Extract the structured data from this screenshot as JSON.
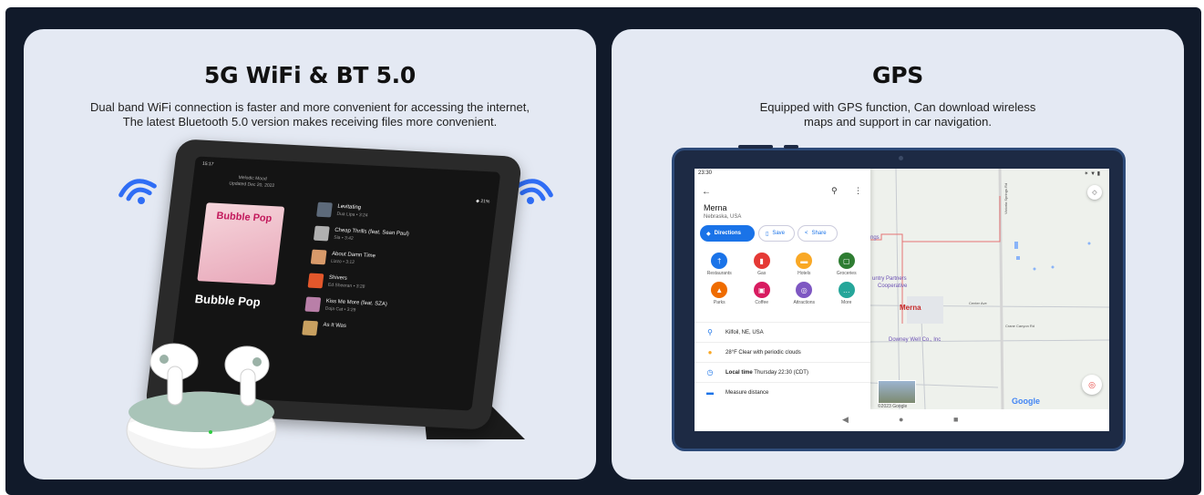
{
  "left_card": {
    "title": "5G WiFi & BT 5.0",
    "desc_line1": "Dual band WiFi connection is faster and more convenient for accessing the internet,",
    "desc_line2": "The latest Bluetooth 5.0 version makes receiving files more convenient.",
    "icons": [
      "wifi-icon-left",
      "wifi-icon-right"
    ],
    "accent_color": "#2f6df5"
  },
  "music_app": {
    "clock": "15:17",
    "battery": "◆ 21%",
    "playlist_meta_1": "Melodic Mood",
    "playlist_meta_2": "Updated Dec 20, 2022",
    "album_text": "Bubble Pop",
    "playlist_title": "Bubble Pop",
    "tracks": [
      {
        "title": "Levitating",
        "sub": "Dua Lipa • 3:24",
        "color": "#5d6a7a"
      },
      {
        "title": "Cheap Thrills (feat. Sean Paul)",
        "sub": "Sia • 3:42",
        "color": "#b0b0b0"
      },
      {
        "title": "About Damn Time",
        "sub": "Lizzo • 3:12",
        "color": "#d89a6a"
      },
      {
        "title": "Shivers",
        "sub": "Ed Sheeran • 3:28",
        "color": "#e3572b"
      },
      {
        "title": "Kiss Me More (feat. SZA)",
        "sub": "Doja Cat • 3:29",
        "color": "#b97fa8"
      },
      {
        "title": "As It Was",
        "sub": "",
        "color": "#c8a060"
      }
    ]
  },
  "right_card": {
    "title": "GPS",
    "desc_line1": "Equipped with GPS function, Can download wireless",
    "desc_line2": "maps and support in car navigation."
  },
  "maps_app": {
    "time": "23:30",
    "status_icons": "✶ ▼ ▮",
    "place_name": "Merna",
    "place_region": "Nebraska, USA",
    "directions_label": "Directions",
    "save_label": "Save",
    "share_label": "Share",
    "categories": [
      {
        "label": "Restaurants",
        "color": "#1a73e8",
        "glyph": "†"
      },
      {
        "label": "Gas",
        "color": "#e53935",
        "glyph": "▮"
      },
      {
        "label": "Hotels",
        "color": "#f9a825",
        "glyph": "▬"
      },
      {
        "label": "Groceries",
        "color": "#2e7d32",
        "glyph": "▢"
      },
      {
        "label": "Parks",
        "color": "#ef6c00",
        "glyph": "▲"
      },
      {
        "label": "Coffee",
        "color": "#d81b60",
        "glyph": "▣"
      },
      {
        "label": "Attractions",
        "color": "#7e57c2",
        "glyph": "◎"
      },
      {
        "label": "More",
        "color": "#26a69a",
        "glyph": "…"
      }
    ],
    "info": {
      "address": "Kilfoil, NE, USA",
      "weather": "28°F Clear with periodic clouds",
      "local_time_label": "Local time",
      "local_time_value": "Thursday 22:30 (CDT)",
      "measure": "Measure distance"
    },
    "map_labels": {
      "town": "Merna",
      "partners": "untry Partners",
      "partners2": "Cooperative",
      "downey": "Downey Well Co., Inc",
      "ngs": "ngs",
      "center_ave": "Center Ave",
      "crane_canyon": "Crane Canyon Rd",
      "victoria": "Victoria Springs Rd",
      "google": "Google",
      "copyright": "©2023 Google"
    },
    "nav": {
      "back": "◀",
      "home": "●",
      "recents": "■"
    }
  }
}
